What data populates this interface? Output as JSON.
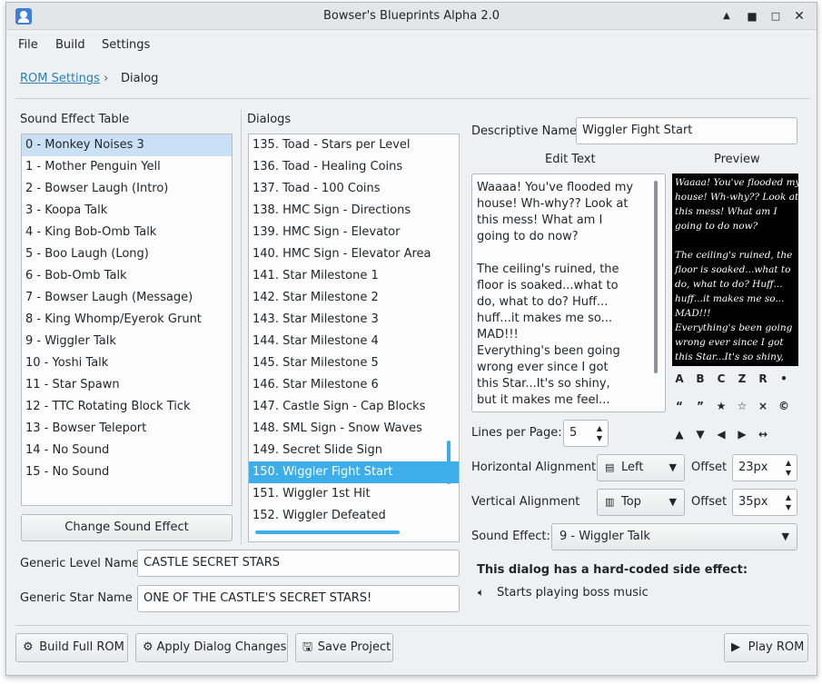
{
  "window": {
    "title": "Bowser's Blueprints Alpha 2.0",
    "controls": {
      "minimize": "▲",
      "maximize": "□",
      "restore": "■",
      "close": "✕"
    }
  },
  "menubar": {
    "items": [
      "File",
      "Build",
      "Settings"
    ]
  },
  "breadcrumb": {
    "link": "ROM Settings",
    "separator": "›",
    "current": "Dialog"
  },
  "sound_table": {
    "label": "Sound Effect Table",
    "items": [
      "0 - Monkey Noises 3",
      "1 - Mother Penguin Yell",
      "2 - Bowser Laugh (Intro)",
      "3 - Koopa Talk",
      "4 - King Bob-Omb Talk",
      "5 - Boo Laugh (Long)",
      "6 - Bob-Omb Talk",
      "7 - Bowser Laugh (Message)",
      "8 - King Whomp/Eyerok Grunt",
      "9 - Wiggler Talk",
      "10 - Yoshi Talk",
      "11 - Star Spawn",
      "12 - TTC Rotating Block Tick",
      "13 - Bowser Teleport",
      "14 - No Sound",
      "15 - No Sound"
    ],
    "selected_index": 0,
    "change_button": "Change Sound Effect"
  },
  "dialogs": {
    "label": "Dialogs",
    "items": [
      "135. Toad - Stars per Level",
      "136. Toad - Healing Coins",
      "137. Toad - 100 Coins",
      "138. HMC Sign - Directions",
      "139. HMC Sign - Elevator",
      "140. HMC Sign - Elevator Area",
      "141. Star Milestone 1",
      "142. Star Milestone 2",
      "143. Star Milestone 3",
      "144. Star Milestone 4",
      "145. Star Milestone 5",
      "146. Star Milestone 6",
      "147. Castle Sign - Cap Blocks",
      "148. SML Sign - Snow Waves",
      "149. Secret Slide Sign",
      "150. Wiggler Fight Start",
      "151. Wiggler 1st Hit",
      "152. Wiggler Defeated"
    ],
    "selected_index": 15
  },
  "editor": {
    "descriptive_name_label": "Descriptive Name",
    "descriptive_name_value": "Wiggler Fight Start",
    "edit_text_label": "Edit Text",
    "preview_label": "Preview",
    "edit_text_lines": [
      "Waaaa! You've flooded my",
      "house! Wh-why?? Look at",
      "this mess! What am I",
      "going to do now?",
      "",
      "The ceiling's ruined, the",
      "floor is soaked...what to",
      "do, what to do? Huff...",
      "huff...it makes me so...",
      "MAD!!!",
      "Everything's been going",
      "wrong ever since I got",
      "this Star...It's so shiny,",
      "but it makes me feel..."
    ],
    "preview_lines": [
      "Waaaa! You've flooded my",
      "house! Wh-why?? Look at",
      "this mess! What am I",
      "going to do now?",
      "",
      "The ceiling's ruined, the",
      "floor is soaked...what to",
      "do, what to do? Huff...",
      "huff...it makes me so...",
      "MAD!!!",
      "Everything's been going",
      "wrong ever since I got",
      "this Star...It's so shiny,"
    ],
    "symbol_row1": [
      "A",
      "B",
      "C",
      "Z",
      "R",
      "•"
    ],
    "symbol_row2": [
      "“",
      "”",
      "★",
      "☆",
      "×",
      "©"
    ],
    "symbol_row3": [
      "▲",
      "▼",
      "◀",
      "▶",
      "↔"
    ],
    "lines_per_page_label": "Lines per Page:",
    "lines_per_page_value": "5",
    "h_align_label": "Horizontal Alignment",
    "h_align_value": "Left",
    "v_align_label": "Vertical Alignment",
    "v_align_value": "Top",
    "offset_label": "Offset",
    "h_offset_value": "23px",
    "v_offset_value": "35px",
    "sound_effect_label": "Sound Effect:",
    "sound_effect_value": "9 - Wiggler Talk",
    "side_effect_heading": "This dialog has a hard-coded side effect:",
    "side_effect_text": "Starts playing boss music"
  },
  "level": {
    "generic_level_label": "Generic Level Name",
    "generic_level_value": "CASTLE SECRET STARS",
    "generic_star_label": "Generic Star Name",
    "generic_star_value": "ONE OF THE CASTLE'S SECRET STARS!"
  },
  "footer": {
    "build_full_rom": "Build Full ROM",
    "apply_dialog_changes": "Apply Dialog Changes",
    "save_project": "Save Project",
    "play_rom": "Play ROM"
  }
}
